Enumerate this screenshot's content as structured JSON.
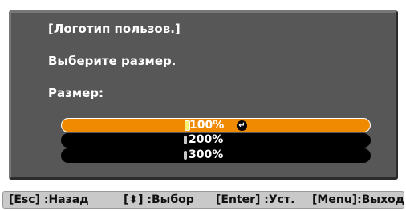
{
  "menu": {
    "title": "[Логотип пользов.]",
    "instruction": "Выберите размер.",
    "size_label": "Размер:",
    "options": [
      {
        "label": "100%",
        "selected": true
      },
      {
        "label": "200%",
        "selected": false
      },
      {
        "label": "300%",
        "selected": false
      }
    ],
    "enter_icon": "enter-return-icon"
  },
  "helpbar": {
    "items": [
      "[Esc] :Назад",
      "[⬍] :Выбор",
      "[Enter] :Уст.",
      "[Menu]:Выход"
    ]
  },
  "colors": {
    "panel_bg": "#575757",
    "selected_bg": "#f08a00",
    "option_bg": "#000000",
    "helpbar_bg": "#c9c9c9"
  }
}
